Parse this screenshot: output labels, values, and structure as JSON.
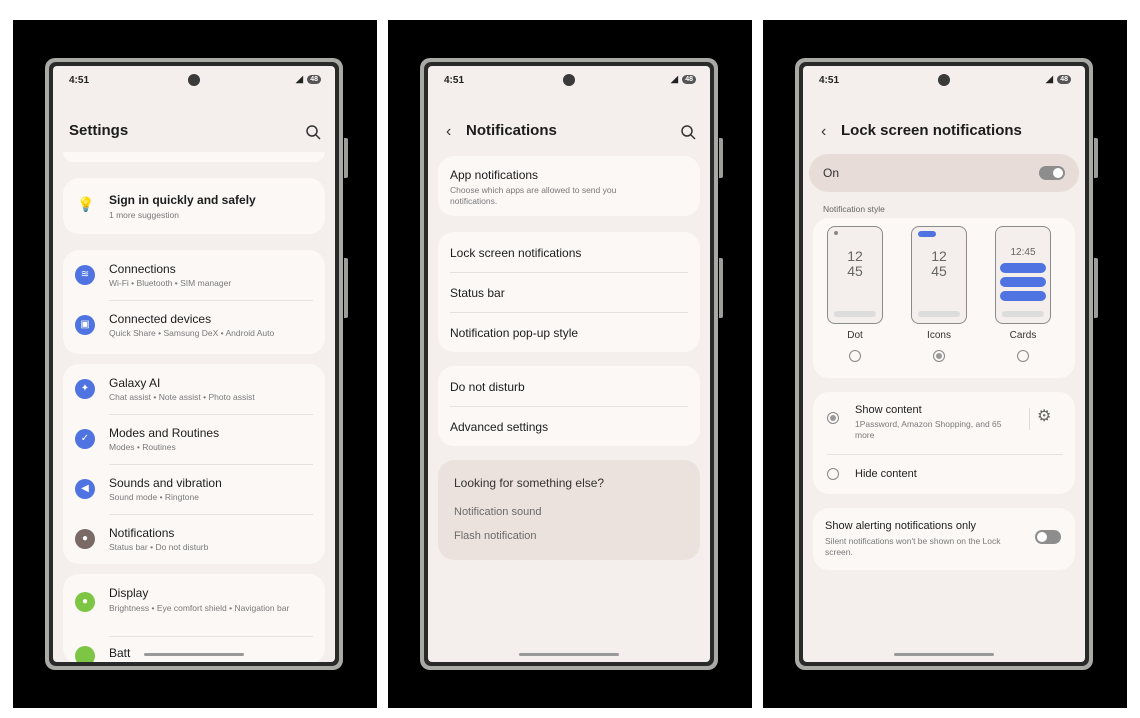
{
  "status": {
    "time": "4:51",
    "battery": "48"
  },
  "screen1": {
    "title": "Settings",
    "sign_in": {
      "title": "Sign in quickly and safely",
      "sub": "1 more suggestion"
    },
    "items": [
      {
        "title": "Connections",
        "sub": "Wi-Fi  •  Bluetooth  •  SIM manager",
        "color": "#4f73e0",
        "icon": "wifi-icon"
      },
      {
        "title": "Connected devices",
        "sub": "Quick Share  •  Samsung DeX  •  Android Auto",
        "color": "#4f73e0",
        "icon": "devices-icon"
      },
      {
        "title": "Galaxy AI",
        "sub": "Chat assist  •  Note assist  •  Photo assist",
        "color": "#4f73e0",
        "icon": "sparkle-icon"
      },
      {
        "title": "Modes and Routines",
        "sub": "Modes  •  Routines",
        "color": "#4f73e0",
        "icon": "check-icon"
      },
      {
        "title": "Sounds and vibration",
        "sub": "Sound mode  •  Ringtone",
        "color": "#4f73e0",
        "icon": "speaker-icon"
      },
      {
        "title": "Notifications",
        "sub": "Status bar  •  Do not disturb",
        "color": "#7a6a66",
        "icon": "bell-icon"
      },
      {
        "title": "Display",
        "sub": "Brightness  •  Eye comfort shield  •  Navigation bar",
        "color": "#7cc644",
        "icon": "sun-icon"
      },
      {
        "title": "Batt",
        "sub": "",
        "color": "#7cc644",
        "icon": "battery-icon"
      }
    ]
  },
  "screen2": {
    "title": "Notifications",
    "app_notifications": {
      "title": "App notifications",
      "sub": "Choose which apps are allowed to send you notifications."
    },
    "group2": [
      "Lock screen notifications",
      "Status bar",
      "Notification pop-up style"
    ],
    "group3": [
      "Do not disturb",
      "Advanced settings"
    ],
    "looking": {
      "title": "Looking for something else?",
      "links": [
        "Notification sound",
        "Flash notification"
      ]
    }
  },
  "screen3": {
    "title": "Lock screen notifications",
    "on_label": "On",
    "on_state": true,
    "style_label": "Notification style",
    "styles": [
      {
        "label": "Dot",
        "clock": [
          "12",
          "45"
        ],
        "selected": false
      },
      {
        "label": "Icons",
        "clock": [
          "12",
          "45"
        ],
        "selected": true
      },
      {
        "label": "Cards",
        "clock": [
          "12:45"
        ],
        "selected": false
      }
    ],
    "show_content": {
      "title": "Show content",
      "sub": "1Password, Amazon Shopping, and 65 more",
      "selected": true
    },
    "hide_content": {
      "title": "Hide content",
      "selected": false
    },
    "alerting": {
      "title": "Show alerting notifications only",
      "sub": "Silent notifications won't be shown on the Lock screen.",
      "state": false
    }
  }
}
